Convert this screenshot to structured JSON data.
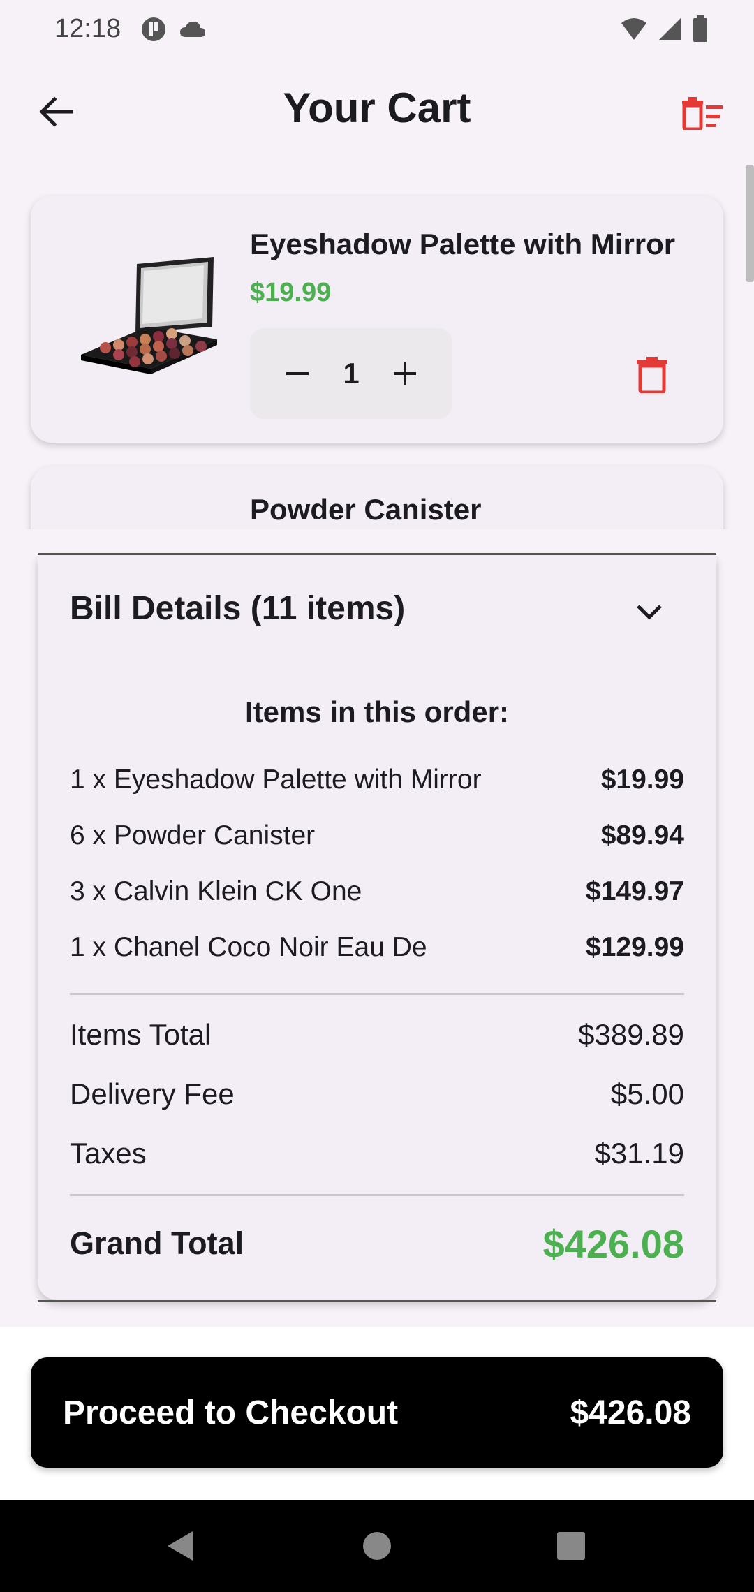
{
  "status_bar": {
    "time": "12:18"
  },
  "header": {
    "title": "Your Cart"
  },
  "cart_items": [
    {
      "name": "Eyeshadow Palette with Mirror",
      "price": "$19.99",
      "quantity": "1"
    },
    {
      "name": "Powder Canister"
    }
  ],
  "bill": {
    "header": "Bill Details (11 items)",
    "items_heading": "Items in this order:",
    "lines": [
      {
        "label": "1 x Eyeshadow Palette with Mirror",
        "amount": "$19.99"
      },
      {
        "label": "6 x Powder Canister",
        "amount": "$89.94"
      },
      {
        "label": "3 x Calvin Klein CK One",
        "amount": "$149.97"
      },
      {
        "label": "1 x Chanel Coco Noir Eau De",
        "amount": "$129.99"
      }
    ],
    "summary": [
      {
        "label": "Items Total",
        "amount": "$389.89"
      },
      {
        "label": "Delivery Fee",
        "amount": "$5.00"
      },
      {
        "label": "Taxes",
        "amount": "$31.19"
      }
    ],
    "grand_total_label": "Grand Total",
    "grand_total": "$426.08"
  },
  "checkout": {
    "label": "Proceed to Checkout",
    "total": "$426.08"
  },
  "colors": {
    "accent_green": "#4caf50",
    "delete_red": "#e53935",
    "checkout_bg": "#000000"
  }
}
